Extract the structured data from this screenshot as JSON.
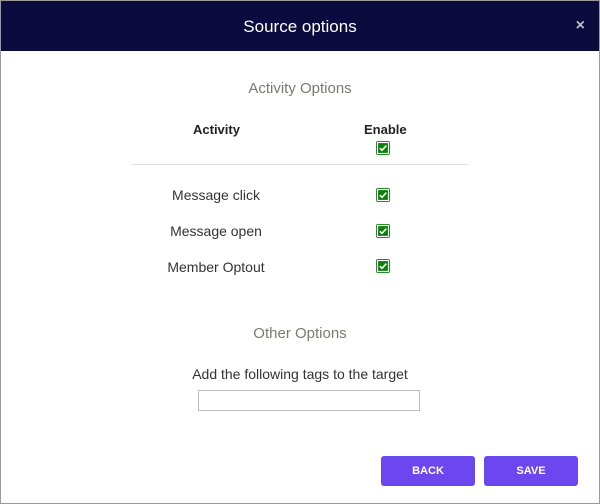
{
  "dialog": {
    "title": "Source options",
    "close_label": "×"
  },
  "activity": {
    "section_title": "Activity Options",
    "col_activity": "Activity",
    "col_enable": "Enable",
    "enable_all_checked": true,
    "rows": [
      {
        "label": "Message click",
        "checked": true
      },
      {
        "label": "Message open",
        "checked": true
      },
      {
        "label": "Member Optout",
        "checked": true
      }
    ]
  },
  "other": {
    "section_title": "Other Options",
    "tags_label": "Add the following tags to the target",
    "tags_value": "",
    "tags_placeholder": ""
  },
  "footer": {
    "back_label": "BACK",
    "save_label": "SAVE"
  },
  "colors": {
    "header_bg": "#0a0a3e",
    "checkbox": "#0d7f0d",
    "button": "#6c47f0",
    "section_title": "#7a7a6e"
  },
  "icons": {
    "close": "close-icon",
    "check": "checkmark-icon"
  }
}
